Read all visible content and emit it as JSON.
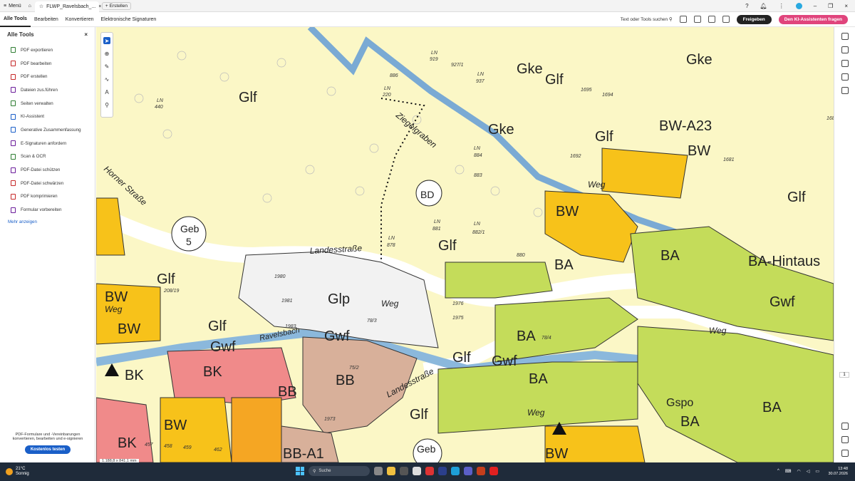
{
  "titlebar": {
    "menu_label": "Menü",
    "tab_title": "FLWP_Ravelsbach_...",
    "new_label": "Erstellen"
  },
  "menubar": {
    "items": [
      "Alle Tools",
      "Bearbeiten",
      "Konvertieren",
      "Elektronische Signaturen"
    ],
    "search_tools": "Text oder Tools suchen",
    "share_label": "Freigeben",
    "ai_label": "Den KI-Assistenten fragen"
  },
  "sidebar": {
    "title": "Alle Tools",
    "items": [
      {
        "label": "PDF exportieren",
        "color": "#2e7d32"
      },
      {
        "label": "PDF bearbeiten",
        "color": "#c62828"
      },
      {
        "label": "PDF erstellen",
        "color": "#c62828"
      },
      {
        "label": "Dateien zus.führen",
        "color": "#6a1b9a"
      },
      {
        "label": "Seiten verwalten",
        "color": "#2e7d32"
      },
      {
        "label": "KI-Assistent",
        "color": "#1a5fc8"
      },
      {
        "label": "Generative Zusammenfassung",
        "color": "#1a5fc8"
      },
      {
        "label": "E-Signaturen anfordern",
        "color": "#6a1b9a"
      },
      {
        "label": "Scan & OCR",
        "color": "#2e7d32"
      },
      {
        "label": "PDF-Datei schützen",
        "color": "#6a1b9a"
      },
      {
        "label": "PDF-Datei schwärzen",
        "color": "#c62828"
      },
      {
        "label": "PDF komprimieren",
        "color": "#c62828"
      },
      {
        "label": "Formular vorbereiten",
        "color": "#6a1b9a"
      }
    ],
    "more": "Mehr anzeigen",
    "promo": "PDF-Formulare und -Vereinbarungen konvertieren, bearbeiten und e-signieren",
    "promo_button": "Kostenlos testen"
  },
  "document": {
    "dimensions": "1.188,8 x 841,1 mm",
    "page_number": "1"
  },
  "map_labels": {
    "glf": "Glf",
    "gke": "Gke",
    "bw": "BW",
    "bw_a23": "BW-A23",
    "ba": "BA",
    "ba_hintaus": "BA-Hintaus",
    "glp": "Glp",
    "gwf": "Gwf",
    "bb": "BB",
    "bb_a1": "BB-A1",
    "bk": "BK",
    "bd": "BD",
    "geb5_a": "Geb",
    "geb5_b": "5",
    "gspo": "Gspo",
    "landesstrasse": "Landesstraße",
    "ziegelgraben": "Ziegelgraben",
    "weg": "Weg",
    "horner_strasse": "Horner Straße",
    "ravelsbach": "Ravelsbach",
    "ln": "LN",
    "p1976": "1976",
    "p1975": "1975",
    "p1973": "1973",
    "p1983": "1983",
    "p1981": "1981",
    "p880": "880",
    "p881": "881",
    "p882_1": "882/1",
    "p878": "878",
    "p884": "884",
    "p883": "883",
    "p919": "919",
    "p927_1": "927/1",
    "p937": "937",
    "p886": "886",
    "p220": "220",
    "p440": "440",
    "p1695": "1695",
    "p1694": "1694",
    "p1692": "1692",
    "p1681": "1681",
    "p1680": "1680",
    "p78_3": "78/3",
    "p75_2": "75/2",
    "p78_4": "78/4",
    "p208_19": "208/19",
    "p458": "458",
    "p459": "459",
    "p462": "462",
    "p457": "457"
  },
  "taskbar": {
    "temp": "21°C",
    "weather": "Sonnig",
    "search": "Suche",
    "time": "13:48",
    "date": "30.07.2026"
  },
  "colors": {
    "map_background": "#fbf7c6",
    "building_yellow": "#f7c21a",
    "residential_green": "#c4dc5a",
    "water_blue": "#8bb8dc",
    "commercial_red": "#f08a8a",
    "brown": "#d8b09a",
    "accent_blue": "#1a5fc8",
    "ai_pink": "#e0447c"
  }
}
